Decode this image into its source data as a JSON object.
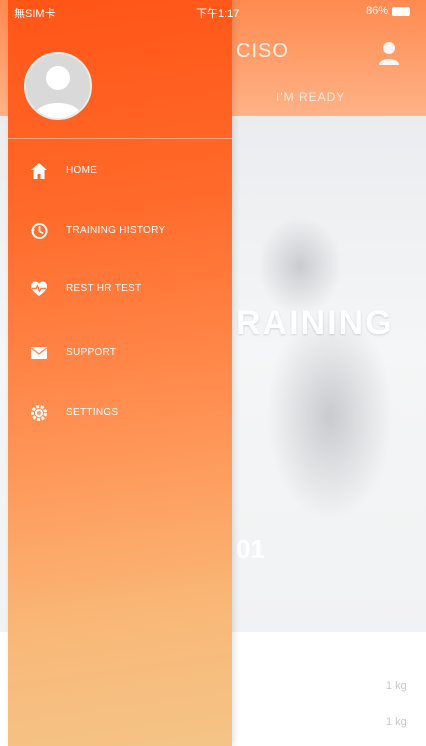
{
  "status_bar": {
    "carrier": "無SIM卡 ",
    "time": "下午1:17",
    "battery_percent": "86%"
  },
  "app": {
    "header_title": "CISO",
    "header_subtitle": "I'M READY",
    "hero_title": "RAINING",
    "hero_caption": "01",
    "stat_marks": [
      "1 kg",
      "1 kg"
    ]
  },
  "drawer": {
    "menu_items": [
      {
        "label": "HOME",
        "icon": "home-icon"
      },
      {
        "label": "TRAINING HISTORY",
        "icon": "history-icon"
      },
      {
        "label": "REST HR TEST",
        "icon": "heart-rate-icon"
      },
      {
        "label": "SUPPORT",
        "icon": "mail-icon"
      },
      {
        "label": "SETTINGS",
        "icon": "settings-icon"
      }
    ]
  },
  "colors": {
    "drawer_top": "#ff5517",
    "drawer_bottom": "#f4c487",
    "header_accent": "#ff8a4f"
  }
}
